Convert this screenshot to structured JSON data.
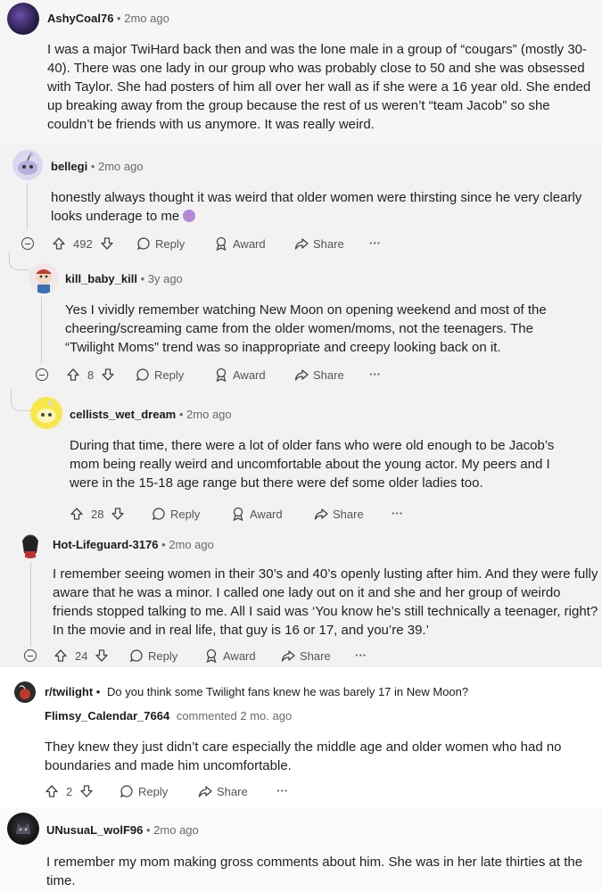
{
  "comments": [
    {
      "user": "AshyCoal76",
      "time": "2mo ago",
      "text": "I was a major TwiHard back then and was the lone male in a group of “cougars” (mostly 30-40). There was one lady in our group who was probably close to 50 and she was obsessed with Taylor. She had posters of him all over her wall as if she were a 16 year old. She ended up breaking away from the group because the rest of us weren’t “team Jacob” so she couldn’t be friends with us anymore. It was really weird.",
      "lines": [
        "I was a major TwiHard back then and was the lone male in a group of “cougars” (mostly 30-",
        "40). There was one lady in our group who was probably close to 50 and she was obsessed",
        "with Taylor. She had posters of him all over her wall as if she were a 16 year old. She ended",
        "up breaking away from the group because the rest of us weren’t “team Jacob” so she",
        "couldn’t be friends with us anymore. It was really weird."
      ]
    },
    {
      "user": "bellegi",
      "time": "2mo ago",
      "lines": [
        "honestly always thought it was weird that older women were thirsting since he very clearly",
        "looks underage to me"
      ],
      "votes": "492"
    },
    {
      "user": "kill_baby_kill",
      "time": "3y ago",
      "lines": [
        "Yes I vividly remember watching New Moon on opening weekend and most of the",
        "cheering/screaming came from the older women/moms, not the teenagers. The",
        "“Twilight Moms” trend was so inappropriate and creepy looking back on it."
      ],
      "votes": "8"
    },
    {
      "user": "cellists_wet_dream",
      "time": "2mo ago",
      "lines": [
        "During that time, there were a lot of older fans who were old enough to be Jacob’s",
        "mom being really weird and uncomfortable about the young actor. My peers and I",
        "were in the 15-18 age range but there were def some older ladies too."
      ],
      "votes": "28"
    },
    {
      "user": "Hot-Lifeguard-3176",
      "time": "2mo ago",
      "lines": [
        "I remember seeing women in their 30’s and 40’s openly lusting after him. And they were fully",
        "aware that he was a minor. I called one lady out on it and she and her group of weirdo",
        "friends stopped talking to me. All I said was ‘You know he’s still technically a teenager, right?",
        "In the movie and in real life, that guy is 16 or 17, and you’re 39.’"
      ],
      "votes": "24"
    },
    {
      "subreddit": "r/twilight",
      "post_title": "Do you think some Twilight fans knew he was barely 17 in New Moon?",
      "user": "Flimsy_Calendar_7664",
      "time": "commented 2 mo. ago",
      "lines": [
        "They knew they just didn’t care especially the middle age and older women who had no",
        "boundaries and made him uncomfortable."
      ],
      "votes": "2"
    },
    {
      "user": "UNusuaL_wolF96",
      "time": "2mo ago",
      "lines": [
        "I remember my mom making gross comments about him. She was in her late thirties at the",
        "time."
      ]
    }
  ],
  "actions": {
    "reply": "Reply",
    "award": "Award",
    "share": "Share",
    "more": "···"
  },
  "sep": "•",
  "colors": {
    "accent": "#1c1c1c",
    "meta": "#6a6a6a"
  }
}
